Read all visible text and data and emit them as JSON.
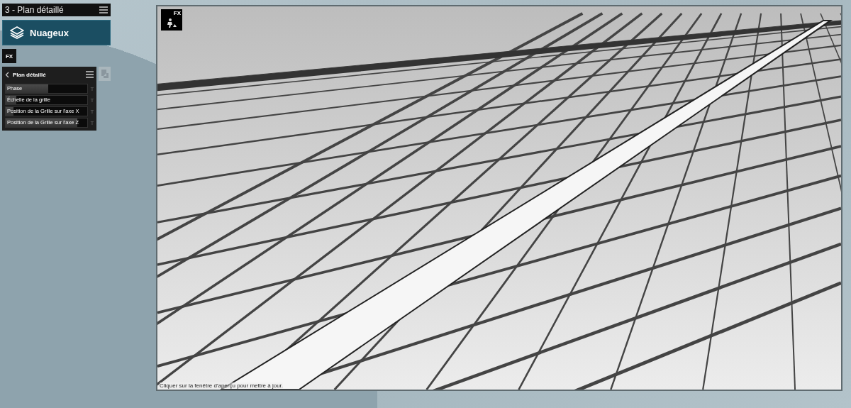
{
  "header": {
    "title": "3 - Plan détaillé"
  },
  "preset": {
    "label": "Nuageux"
  },
  "fx_button": {
    "label": "FX"
  },
  "panel": {
    "title": "Plan détaillé",
    "sliders": [
      {
        "label": "Phase",
        "level": 0.52,
        "type_marker": "T"
      },
      {
        "label": "Échelle de la grille",
        "level": 0.13,
        "type_marker": "T"
      },
      {
        "label": "Position de la Grille sur l'axe X",
        "level": 0.1,
        "type_marker": "T"
      },
      {
        "label": "Position de la Grille sur l'axe Z",
        "level": 0.88,
        "type_marker": "T"
      }
    ]
  },
  "viewport": {
    "badge": "FX",
    "status": "Cliquer sur la fenêtre d'aperçu pour mettre à jour."
  }
}
